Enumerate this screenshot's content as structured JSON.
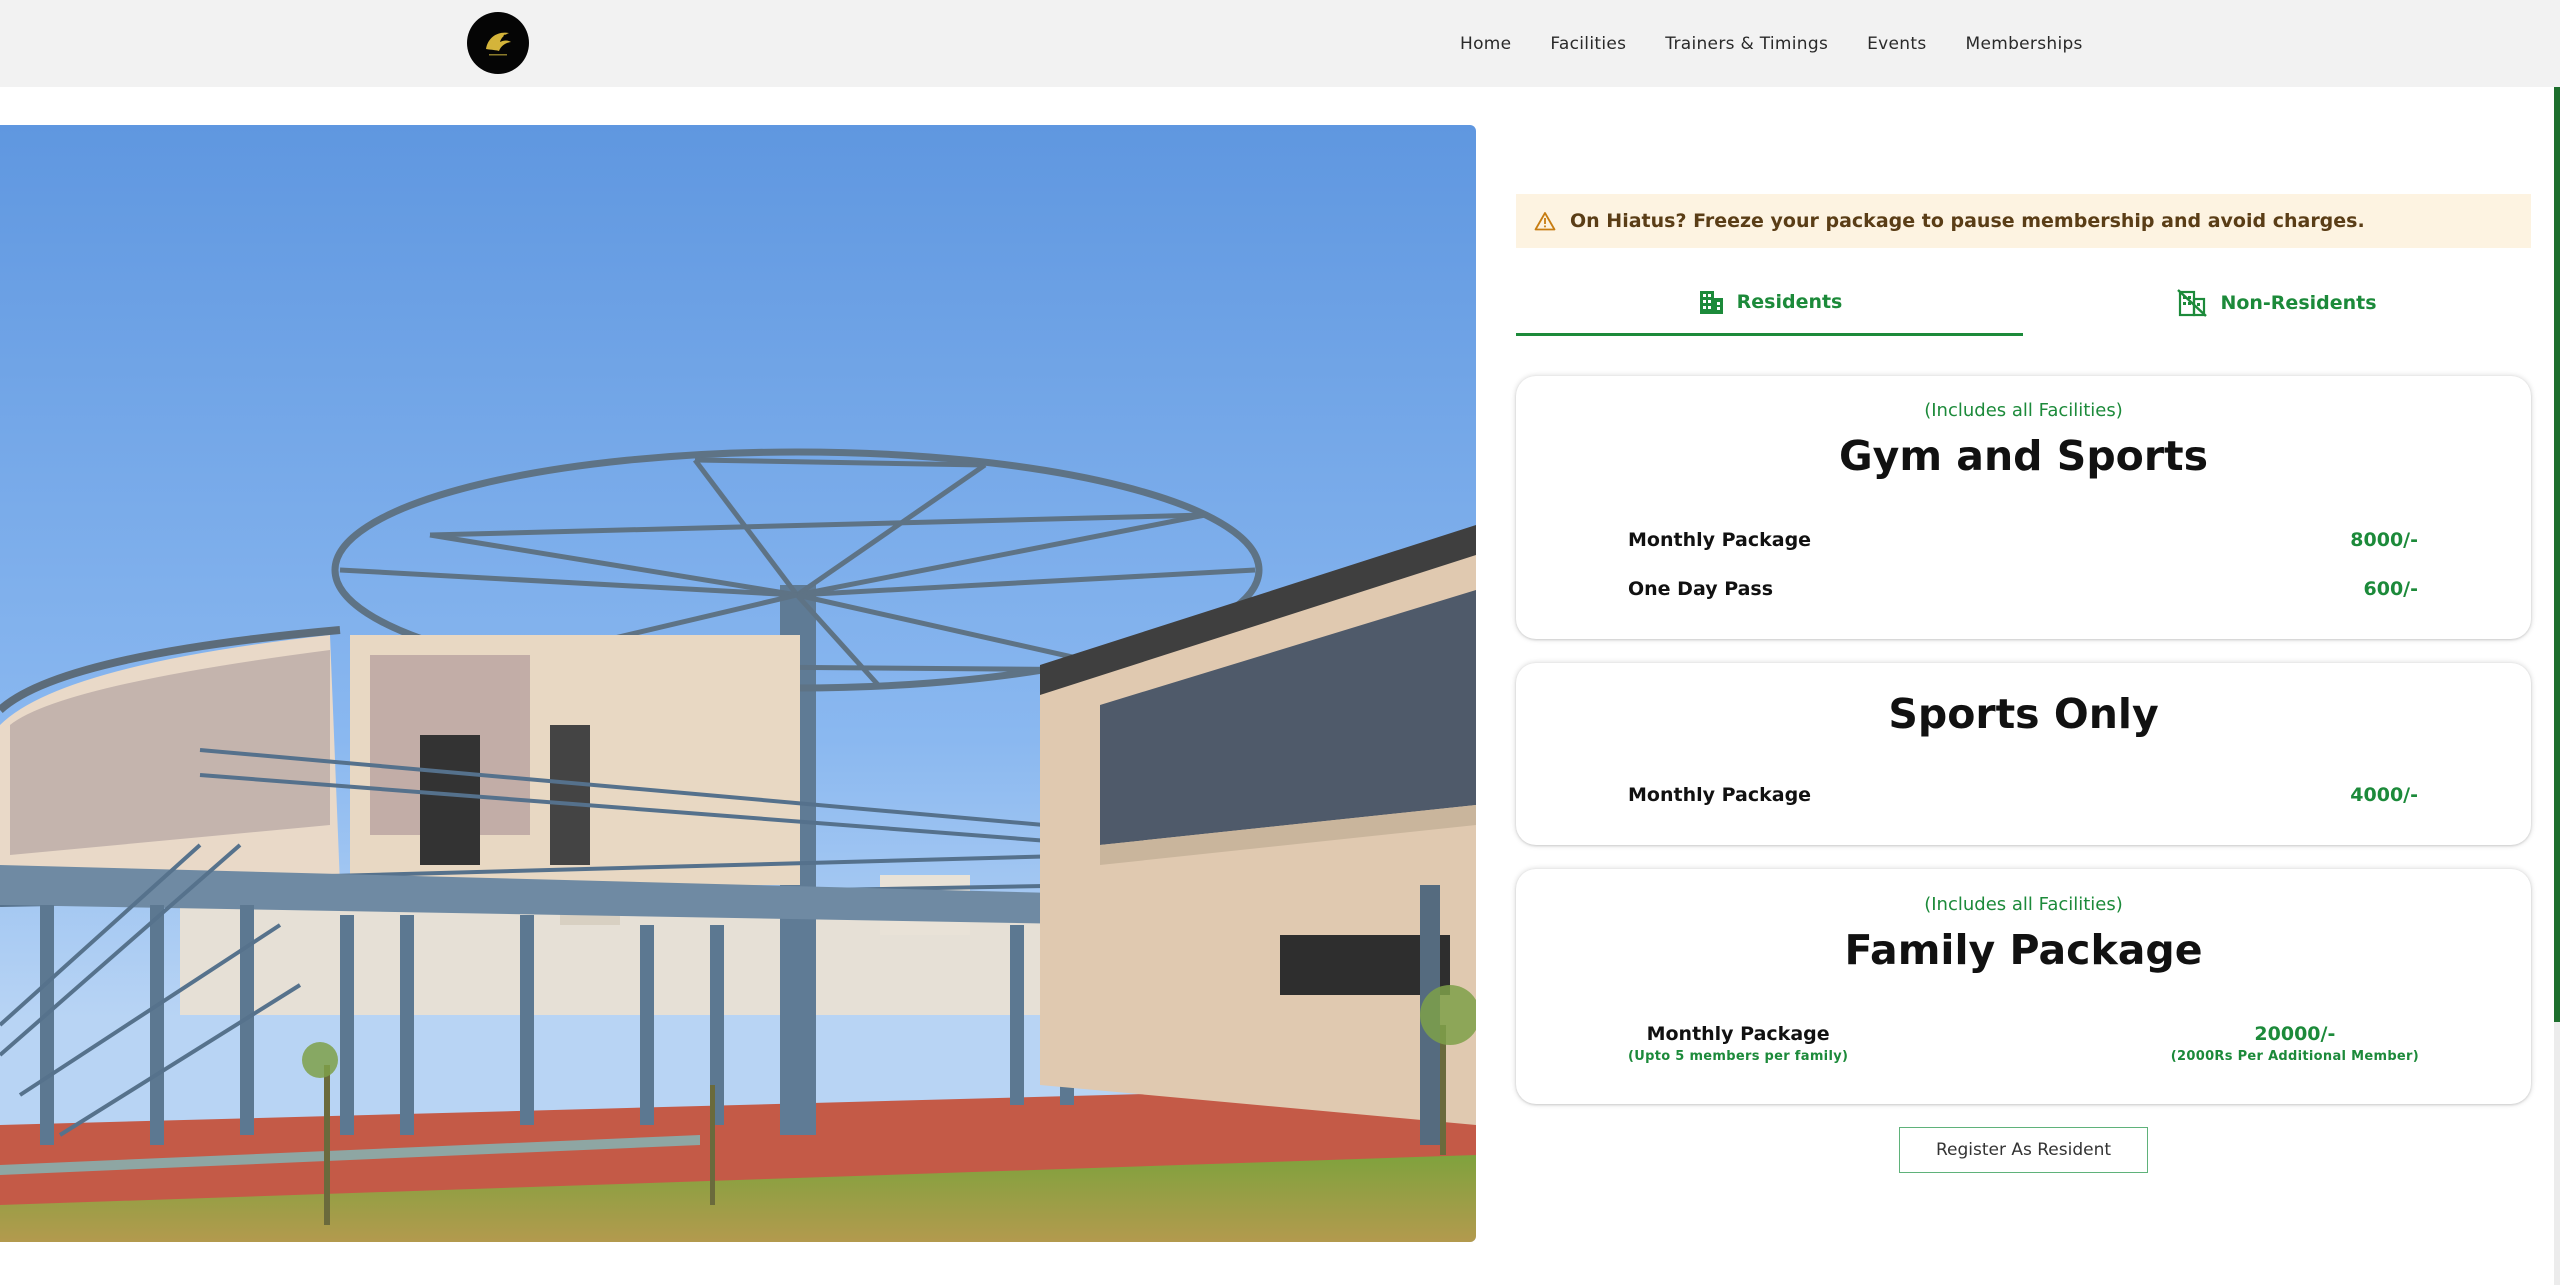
{
  "nav": {
    "logo_icon": "eagle-logo-icon",
    "links": [
      "Home",
      "Facilities",
      "Trainers & Timings",
      "Events",
      "Memberships"
    ]
  },
  "hero": {
    "image_description_icon": "sports-complex-photo"
  },
  "alert": {
    "icon": "warning-icon",
    "text": "On Hiatus? Freeze your package to pause membership and avoid charges."
  },
  "tabs": [
    {
      "label": "Residents",
      "icon": "building-icon",
      "active": true
    },
    {
      "label": "Non-Residents",
      "icon": "building-off-icon",
      "active": false
    }
  ],
  "packages": {
    "gym": {
      "includes": "(Includes all Facilities)",
      "title": "Gym and Sports",
      "rows": [
        {
          "label": "Monthly Package",
          "price": "8000/-"
        },
        {
          "label": "One Day Pass",
          "price": "600/-"
        }
      ]
    },
    "sports": {
      "title": "Sports Only",
      "rows": [
        {
          "label": "Monthly Package",
          "price": "4000/-"
        }
      ]
    },
    "family": {
      "includes": "(Includes all Facilities)",
      "title": "Family Package",
      "label": "Monthly Package",
      "label_note": "(Upto 5 members per family)",
      "price": "20000/-",
      "price_note": "(2000Rs Per Additional Member)"
    }
  },
  "register_label": "Register As Resident",
  "colors": {
    "accent": "#1c8a3a",
    "navbar_bg": "#f2f2f2",
    "alert_bg": "#fdf3e1",
    "alert_text": "#5a3d16"
  }
}
